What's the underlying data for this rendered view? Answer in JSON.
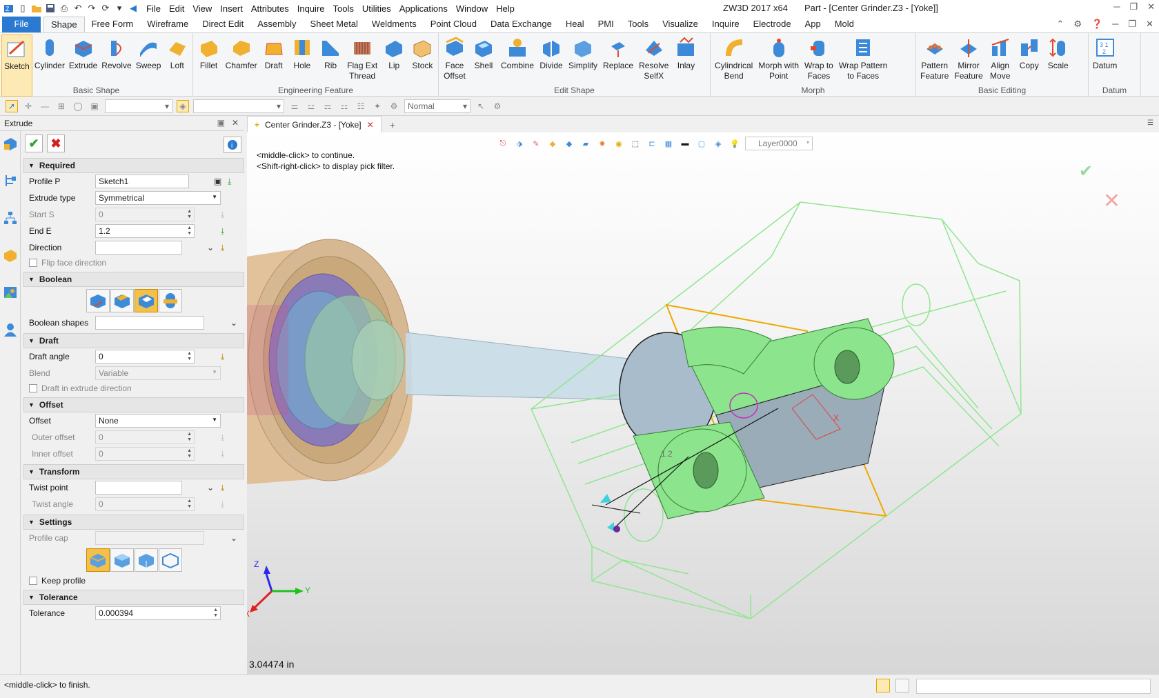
{
  "menu": [
    "File",
    "Edit",
    "View",
    "Insert",
    "Attributes",
    "Inquire",
    "Tools",
    "Utilities",
    "Applications",
    "Window",
    "Help"
  ],
  "app_title": "ZW3D 2017  x64",
  "doc_title": "Part - [Center Grinder.Z3 - [Yoke]]",
  "ribbon_tabs": [
    "File",
    "Shape",
    "Free Form",
    "Wireframe",
    "Direct Edit",
    "Assembly",
    "Sheet Metal",
    "Weldments",
    "Point Cloud",
    "Data Exchange",
    "Heal",
    "PMI",
    "Tools",
    "Visualize",
    "Inquire",
    "Electrode",
    "App",
    "Mold"
  ],
  "active_tab": "Shape",
  "ribbon": {
    "basic_shape": {
      "label": "Basic Shape",
      "buttons": [
        "Sketch",
        "Cylinder",
        "Extrude",
        "Revolve",
        "Sweep",
        "Loft"
      ]
    },
    "engineering_feature": {
      "label": "Engineering Feature",
      "buttons": [
        "Fillet",
        "Chamfer",
        "Draft",
        "Hole",
        "Rib",
        "Flag Ext\nThread",
        "Lip",
        "Stock"
      ]
    },
    "edit_shape": {
      "label": "Edit Shape",
      "buttons": [
        "Face\nOffset",
        "Shell",
        "Combine",
        "Divide",
        "Simplify",
        "Replace",
        "Resolve\nSelfX",
        "Inlay"
      ]
    },
    "morph": {
      "label": "Morph",
      "buttons": [
        "Cylindrical\nBend",
        "Morph with\nPoint",
        "Wrap to\nFaces",
        "Wrap Pattern\nto Faces"
      ]
    },
    "basic_editing": {
      "label": "Basic Editing",
      "buttons": [
        "Pattern\nFeature",
        "Mirror\nFeature",
        "Align\nMove",
        "Copy",
        "Scale"
      ]
    },
    "datum": {
      "label": "Datum",
      "buttons": [
        "Datum"
      ]
    }
  },
  "toolbar2": {
    "combo1": "",
    "combo2": "",
    "normal_combo": "Normal"
  },
  "panel": {
    "title": "Extrude",
    "required": {
      "header": "Required",
      "profile_label": "Profile P",
      "profile_value": "Sketch1",
      "extrude_type_label": "Extrude type",
      "extrude_type_value": "Symmetrical",
      "start_label": "Start S",
      "start_value": "0",
      "end_label": "End E",
      "end_value": "1.2",
      "direction_label": "Direction",
      "direction_value": "",
      "flip_label": "Flip face direction"
    },
    "boolean": {
      "header": "Boolean",
      "shapes_label": "Boolean shapes",
      "shapes_value": ""
    },
    "draft": {
      "header": "Draft",
      "angle_label": "Draft angle",
      "angle_value": "0",
      "blend_label": "Blend",
      "blend_value": "Variable",
      "extrude_dir_label": "Draft in extrude direction"
    },
    "offset": {
      "header": "Offset",
      "offset_label": "Offset",
      "offset_value": "None",
      "outer_label": "Outer offset",
      "outer_value": "0",
      "inner_label": "Inner offset",
      "inner_value": "0"
    },
    "transform": {
      "header": "Transform",
      "twist_point_label": "Twist point",
      "twist_point_value": "",
      "twist_angle_label": "Twist angle",
      "twist_angle_value": "0"
    },
    "settings": {
      "header": "Settings",
      "profile_cap_label": "Profile cap",
      "profile_cap_value": "",
      "keep_profile_label": "Keep profile"
    },
    "tolerance": {
      "header": "Tolerance",
      "tolerance_label": "Tolerance",
      "tolerance_value": "0.000394"
    }
  },
  "doc_tab": "Center Grinder.Z3 - [Yoke]",
  "viewport": {
    "hint1": "<middle-click> to continue.",
    "hint2": "<Shift-right-click> to display pick filter.",
    "layer": "Layer0000",
    "measure": "3.04474 in",
    "dim_label": "1.2",
    "axis_x": "X",
    "axis_y": "Y",
    "axis_z": "Z"
  },
  "status_text": "<middle-click> to finish.",
  "colors": {
    "file_tab": "#2b79d0",
    "active_icon_bg": "#fde9b4",
    "model_green": "#8ce48c",
    "wire_orange": "#f0a800",
    "wire_green": "#8fe68f"
  }
}
